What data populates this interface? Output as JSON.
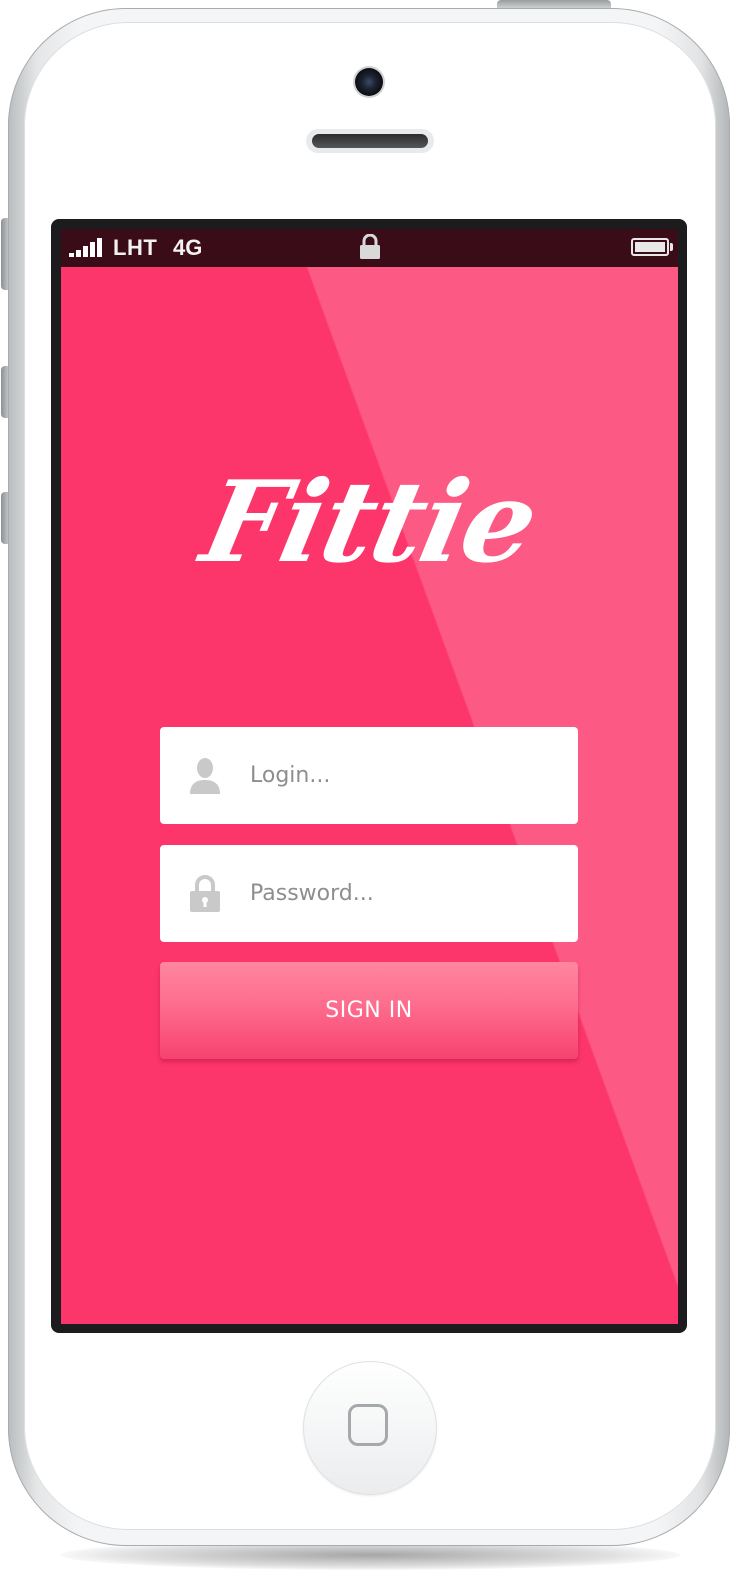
{
  "status_bar": {
    "carrier": "LHT",
    "network": "4G",
    "signal_icon": "signal-strength-icon",
    "lock_icon": "lock-icon",
    "battery_icon": "battery-icon"
  },
  "app": {
    "logo_text": "Fittie",
    "background_color": "#fc356a"
  },
  "login_form": {
    "login_placeholder": "Login...",
    "login_icon": "user-icon",
    "password_placeholder": "Password...",
    "password_icon": "lock-icon",
    "signin_label": "SIGN IN"
  },
  "device": {
    "home_button_icon": "home-button-icon"
  }
}
